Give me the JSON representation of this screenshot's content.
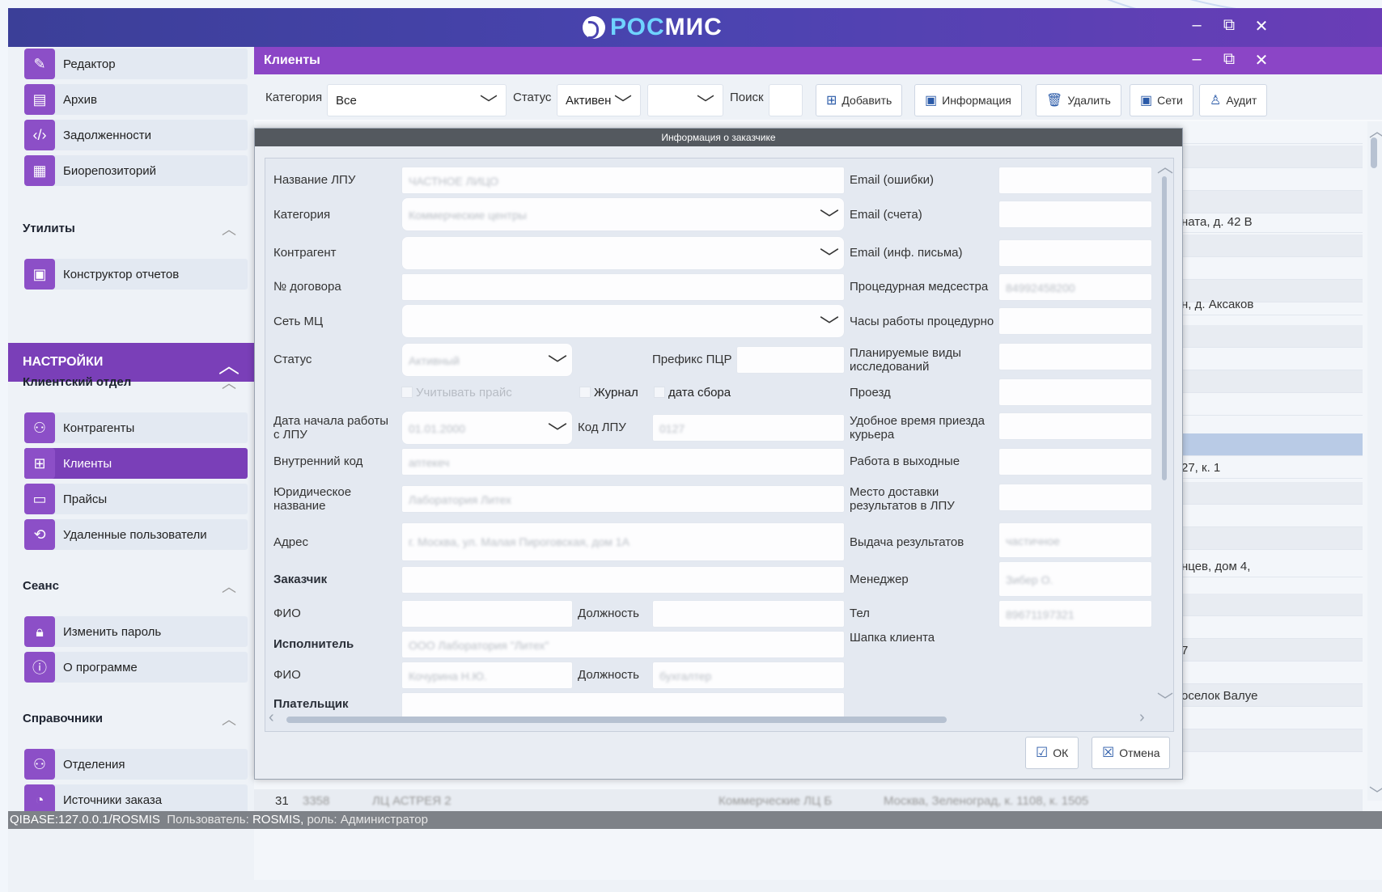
{
  "app": {
    "brand_prefix": "РОС",
    "brand_suffix": "МИС",
    "window_controls": {
      "minimize": "–",
      "restore": "⧉",
      "close": "✕"
    }
  },
  "sidebar": {
    "top_items": [
      {
        "label": "Редактор",
        "icon": "edit-icon"
      },
      {
        "label": "Архив",
        "icon": "archive-icon"
      },
      {
        "label": "Задолженности",
        "icon": "code-icon"
      },
      {
        "label": "Биорепозиторий",
        "icon": "grid-icon"
      }
    ],
    "utilities_title": "Утилиты",
    "utilities_items": [
      {
        "label": "Конструктор отчетов",
        "icon": "report-builder-icon"
      }
    ],
    "settings_title": "НАСТРОЙКИ",
    "client_dept_title": "Клиентский отдел",
    "client_dept_items": [
      {
        "label": "Контрагенты",
        "icon": "people-icon"
      },
      {
        "label": "Клиенты",
        "icon": "org-icon",
        "active": true
      },
      {
        "label": "Прайсы",
        "icon": "box-icon"
      },
      {
        "label": "Удаленные пользователи",
        "icon": "sync-user-icon"
      }
    ],
    "session_title": "Сеанс",
    "session_items": [
      {
        "label": "Изменить пароль",
        "icon": "lock-refresh-icon"
      },
      {
        "label": "О программе",
        "icon": "info-icon"
      }
    ],
    "references_title": "Справочники",
    "references_items": [
      {
        "label": "Отделения",
        "icon": "department-icon"
      },
      {
        "label": "Источники заказа",
        "icon": "chart-icon"
      }
    ]
  },
  "main": {
    "title": "Клиенты",
    "toolbar": {
      "category_label": "Категория",
      "category_value": "Все",
      "status_label": "Статус",
      "status_value": "Активен",
      "extra_value": "",
      "search_label": "Поиск",
      "search_value": "",
      "buttons": {
        "add": "Добавить",
        "info": "Информация",
        "delete": "Удалить",
        "networks": "Сети",
        "audit": "Аудит"
      }
    },
    "table_visible_text": [
      "ната, д. 42 В",
      "н, д. Аксаков",
      "27, к. 1",
      "нцев, дом 4,",
      "7",
      "оселок Валуе"
    ],
    "last_row": {
      "num": "31",
      "code": "3358",
      "name": "ЛЦ АСТРЕЯ 2",
      "category": "Коммерческие ЛЦ Б",
      "address": "Москва, Зеленоград, к. 1108, к. 1505"
    }
  },
  "dialog": {
    "title": "Информация о заказчике",
    "left": {
      "lpu_name_label": "Название ЛПУ",
      "lpu_name_value": "ЧАСТНОЕ ЛИЦО",
      "category_label": "Категория",
      "category_value": "Коммерческие центры",
      "counterparty_label": "Контрагент",
      "counterparty_value": "",
      "contract_label": "№ договора",
      "contract_value": "",
      "network_label": "Сеть МЦ",
      "network_value": "",
      "status_label": "Статус",
      "status_value": "Активный",
      "pcr_prefix_label": "Префикс ПЦР",
      "pcr_prefix_value": "",
      "chk_price": "Учитывать прайс",
      "chk_journal": "Журнал",
      "chk_date": "дата сбора",
      "start_date_label": "Дата начала работы с ЛПУ",
      "start_date_value": "01.01.2000",
      "lpu_code_label": "Код ЛПУ",
      "lpu_code_value": "0127",
      "internal_code_label": "Внутренний код",
      "internal_code_value": "аптекеч",
      "legal_name_label": "Юридическое название",
      "legal_name_value": "Лаборатория Литех",
      "address_label": "Адрес",
      "address_value": "г. Москва, ул. Малая Пироговская, дом 1А",
      "customer_label": "Заказчик",
      "customer_value": "",
      "fio1_label": "ФИО",
      "fio1_value": "",
      "position1_label": "Должность",
      "position1_value": "",
      "executor_label": "Исполнитель",
      "executor_value": "ООО Лаборатория \"Литех\"",
      "fio2_label": "ФИО",
      "fio2_value": "Кочурина Н.Ю.",
      "position2_label": "Должность",
      "position2_value": "бухгалтер",
      "payer_label": "Плательщик",
      "payer_value": ""
    },
    "right": {
      "email_errors_label": "Email (ошибки)",
      "email_invoices_label": "Email (счета)",
      "email_letters_label": "Email (инф. письма)",
      "nurse_label": "Процедурная медсестра",
      "nurse_value": "84992458200",
      "hours_label": "Часы работы процедурно",
      "planned_label": "Планируемые виды исследований",
      "travel_label": "Проезд",
      "courier_label": "Удобное время приезда курьера",
      "weekend_label": "Работа в выходные",
      "delivery_label": "Место доставки результатов в ЛПУ",
      "issue_label": "Выдача результатов",
      "issue_value": "частичное",
      "manager_label": "Менеджер",
      "manager_value": "Зибер О.",
      "phone_label": "Тел",
      "phone_value": "89671197321",
      "header_label": "Шапка клиента"
    },
    "ok_label": "ОК",
    "cancel_label": "Отмена"
  },
  "statusbar": {
    "db": "QIBASE:127.0.0.1/ROSMIS",
    "user_prefix": "Пользователь:",
    "user": "ROSMIS,",
    "role_prefix": "роль:",
    "role": "Администратор"
  }
}
